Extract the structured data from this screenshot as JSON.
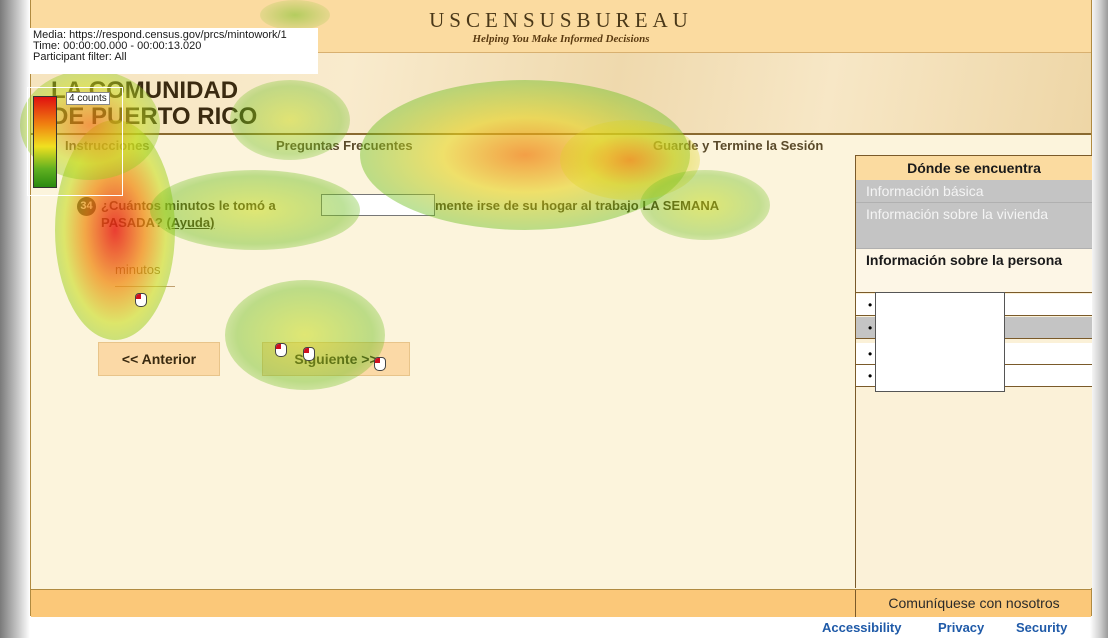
{
  "header": {
    "agency": "USCENSUSBUREAU",
    "tagline": "Helping You Make Informed Decisions"
  },
  "banner": {
    "title_line1": "LA COMUNIDAD",
    "title_line2": "DE PUERTO RICO"
  },
  "nav": {
    "instructions": "Instrucciones",
    "faq": "Preguntas Frecuentes",
    "save_exit": "Guarde y Termine la Sesión"
  },
  "question": {
    "number": "34",
    "text_before": "¿Cuántos minutos le tomó a",
    "text_after": "usualmente irse de su hogar al trabajo LA SEMANA PASADA?",
    "help": "(Ayuda)",
    "unit": "minutos",
    "answer_value": ""
  },
  "buttons": {
    "previous": "<<  Anterior",
    "next": "Siguiente  >>"
  },
  "sidebar": {
    "header": "Dónde se encuentra",
    "items": [
      {
        "label": "Información básica",
        "state": "completed"
      },
      {
        "label": "Información sobre la vivienda",
        "state": "completed"
      },
      {
        "label": "Información sobre la persona",
        "state": "current"
      }
    ],
    "sub_rows": [
      "•",
      "•",
      "•",
      "•"
    ]
  },
  "footer": {
    "contact": "Comuníquese con nosotros"
  },
  "links": {
    "accessibility": "Accessibility",
    "privacy": "Privacy",
    "security": "Security"
  },
  "overlay": {
    "media": "Media: https://respond.census.gov/prcs/mintowork/1",
    "time": "Time: 00:00:00.000 - 00:00:13.020",
    "filter": "Participant filter: All",
    "legend_count": "4 counts"
  },
  "colors": {
    "accent": "#fbdba0",
    "link": "#1f5aa8",
    "heat_high": "#e01010",
    "heat_low": "#2a8a10"
  }
}
